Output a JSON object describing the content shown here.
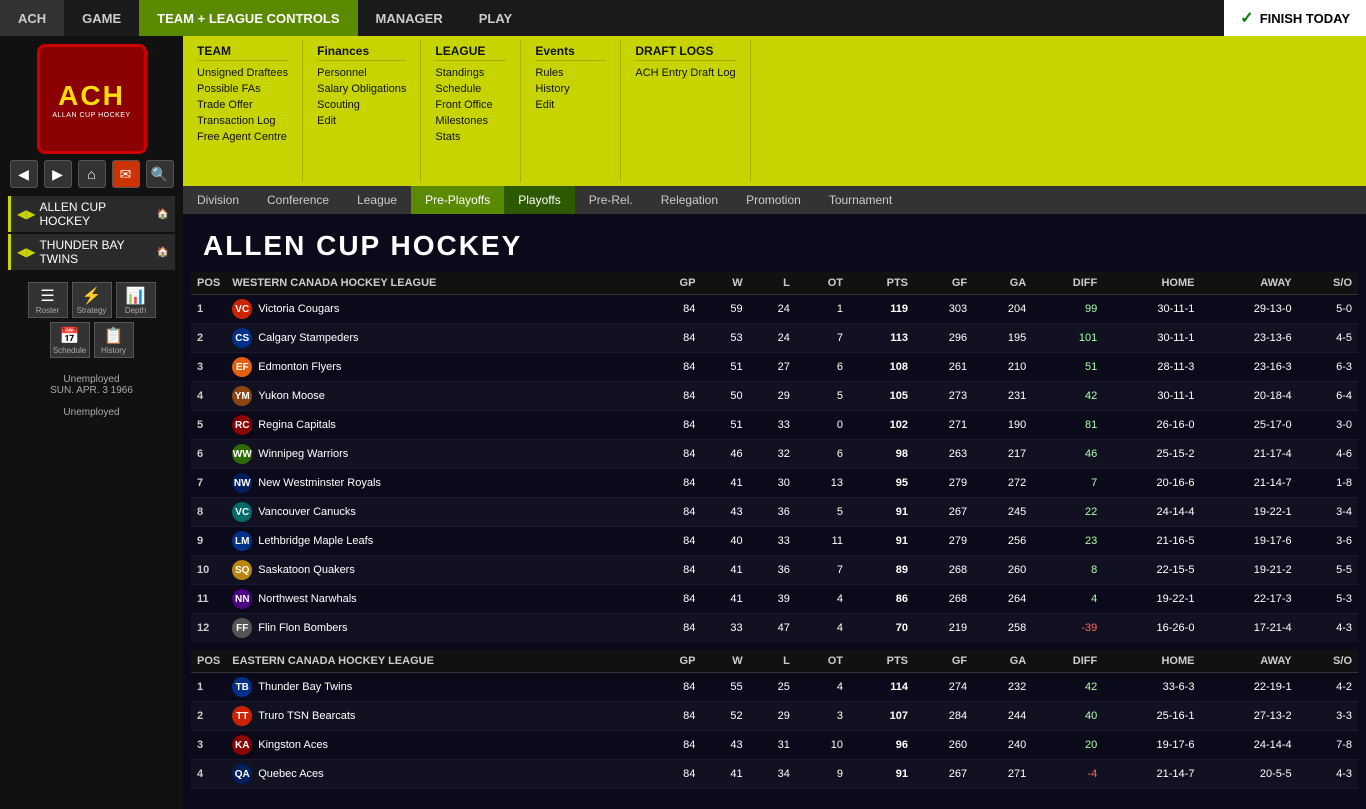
{
  "topNav": {
    "items": [
      {
        "label": "ACH",
        "active": false
      },
      {
        "label": "GAME",
        "active": false
      },
      {
        "label": "TEAM + LEAGUE CONTROLS",
        "active": true
      },
      {
        "label": "MANAGER",
        "active": false
      },
      {
        "label": "PLAY",
        "active": false
      }
    ],
    "finishToday": "FINISH TODAY"
  },
  "sidebar": {
    "logo": {
      "main": "ACH",
      "sub": "ALLAN CUP HOCKEY"
    },
    "userInfo": {
      "status": "Unemployed",
      "date": "SUN. APR. 3 1966",
      "role": "Unemployed"
    },
    "navButtons": [
      "◀",
      "▶",
      "⌂",
      "✉",
      "🔍"
    ],
    "teams": [
      {
        "label": "ALLEN CUP HOCKEY",
        "arrow": "◀▶"
      },
      {
        "label": "THUNDER BAY TWINS",
        "arrow": "◀▶"
      }
    ],
    "icons": [
      {
        "icon": "☰",
        "label": "Roster"
      },
      {
        "icon": "⚡",
        "label": "Strategy"
      },
      {
        "icon": "📊",
        "label": "Depth"
      },
      {
        "icon": "📅",
        "label": "Schedule"
      },
      {
        "icon": "📋",
        "label": "History"
      }
    ]
  },
  "megaMenu": {
    "team": {
      "header": "TEAM",
      "items": [
        "Unsigned Draftees",
        "Possible FAs",
        "Trade Offer",
        "Transaction Log",
        "Free Agent Centre"
      ]
    },
    "league": {
      "header": "LEAGUE",
      "items": [
        "Standings",
        "Schedule",
        "Front Office",
        "Milestones",
        "Stats"
      ]
    },
    "finances": {
      "header": "Finances",
      "items": [
        "Personnel",
        "Salary Obligations",
        "Scouting",
        "Edit"
      ]
    },
    "events": {
      "header": "Events",
      "items": [
        "Rules",
        "History",
        "Edit"
      ]
    },
    "draftLogs": {
      "header": "DRAFT LOGS",
      "items": [
        "ACH Entry Draft Log"
      ]
    }
  },
  "subNav": {
    "items": [
      {
        "label": "Division",
        "active": false
      },
      {
        "label": "Conference",
        "active": false
      },
      {
        "label": "League",
        "active": false
      },
      {
        "label": "Pre-Playoffs",
        "active": true
      },
      {
        "label": "Playoffs",
        "active": true
      },
      {
        "label": "Pre-Rel.",
        "active": false
      },
      {
        "label": "Relegation",
        "active": false
      },
      {
        "label": "Promotion",
        "active": false
      },
      {
        "label": "Tournament",
        "active": false
      }
    ]
  },
  "pageTitle": "ALLEN CUP HOCKEY",
  "westernLeague": {
    "name": "WESTERN CANADA HOCKEY LEAGUE",
    "columns": [
      "POS",
      "WESTERN CANADA HOCKEY LEAGUE",
      "GP",
      "W",
      "L",
      "OT",
      "PTS",
      "GF",
      "GA",
      "DIFF",
      "HOME",
      "AWAY",
      "S/O"
    ],
    "teams": [
      {
        "pos": 1,
        "name": "Victoria Cougars",
        "gp": 84,
        "w": 59,
        "l": 24,
        "ot": 1,
        "pts": 119,
        "gf": 303,
        "ga": 204,
        "diff": 99,
        "home": "30-11-1",
        "away": "29-13-0",
        "so": "5-0",
        "logo": "logo-red"
      },
      {
        "pos": 2,
        "name": "Calgary Stampeders",
        "gp": 84,
        "w": 53,
        "l": 24,
        "ot": 7,
        "pts": 113,
        "gf": 296,
        "ga": 195,
        "diff": 101,
        "home": "30-11-1",
        "away": "23-13-6",
        "so": "4-5",
        "logo": "logo-blue"
      },
      {
        "pos": 3,
        "name": "Edmonton Flyers",
        "gp": 84,
        "w": 51,
        "l": 27,
        "ot": 6,
        "pts": 108,
        "gf": 261,
        "ga": 210,
        "diff": 51,
        "home": "28-11-3",
        "away": "23-16-3",
        "so": "6-3",
        "logo": "logo-orange"
      },
      {
        "pos": 4,
        "name": "Yukon Moose",
        "gp": 84,
        "w": 50,
        "l": 29,
        "ot": 5,
        "pts": 105,
        "gf": 273,
        "ga": 231,
        "diff": 42,
        "home": "30-11-1",
        "away": "20-18-4",
        "so": "6-4",
        "logo": "logo-brown"
      },
      {
        "pos": 5,
        "name": "Regina Capitals",
        "gp": 84,
        "w": 51,
        "l": 33,
        "ot": 0,
        "pts": 102,
        "gf": 271,
        "ga": 190,
        "diff": 81,
        "home": "26-16-0",
        "away": "25-17-0",
        "so": "3-0",
        "logo": "logo-darkred"
      },
      {
        "pos": 6,
        "name": "Winnipeg Warriors",
        "gp": 84,
        "w": 46,
        "l": 32,
        "ot": 6,
        "pts": 98,
        "gf": 263,
        "ga": 217,
        "diff": 46,
        "home": "25-15-2",
        "away": "21-17-4",
        "so": "4-6",
        "logo": "logo-green"
      },
      {
        "pos": 7,
        "name": "New Westminster Royals",
        "gp": 84,
        "w": 41,
        "l": 30,
        "ot": 13,
        "pts": 95,
        "gf": 279,
        "ga": 272,
        "diff": 7,
        "home": "20-16-6",
        "away": "21-14-7",
        "so": "1-8",
        "logo": "logo-navy"
      },
      {
        "pos": 8,
        "name": "Vancouver Canucks",
        "gp": 84,
        "w": 43,
        "l": 36,
        "ot": 5,
        "pts": 91,
        "gf": 267,
        "ga": 245,
        "diff": 22,
        "home": "24-14-4",
        "away": "19-22-1",
        "so": "3-4",
        "logo": "logo-teal"
      },
      {
        "pos": 9,
        "name": "Lethbridge Maple Leafs",
        "gp": 84,
        "w": 40,
        "l": 33,
        "ot": 11,
        "pts": 91,
        "gf": 279,
        "ga": 256,
        "diff": 23,
        "home": "21-16-5",
        "away": "19-17-6",
        "so": "3-6",
        "logo": "logo-blue"
      },
      {
        "pos": 10,
        "name": "Saskatoon Quakers",
        "gp": 84,
        "w": 41,
        "l": 36,
        "ot": 7,
        "pts": 89,
        "gf": 268,
        "ga": 260,
        "diff": 8,
        "home": "22-15-5",
        "away": "19-21-2",
        "so": "5-5",
        "logo": "logo-gold"
      },
      {
        "pos": 11,
        "name": "Northwest Narwhals",
        "gp": 84,
        "w": 41,
        "l": 39,
        "ot": 4,
        "pts": 86,
        "gf": 268,
        "ga": 264,
        "diff": 4,
        "home": "19-22-1",
        "away": "22-17-3",
        "so": "5-3",
        "logo": "logo-purple"
      },
      {
        "pos": 12,
        "name": "Flin Flon Bombers",
        "gp": 84,
        "w": 33,
        "l": 47,
        "ot": 4,
        "pts": 70,
        "gf": 219,
        "ga": 258,
        "diff": -39,
        "home": "16-26-0",
        "away": "17-21-4",
        "so": "4-3",
        "logo": "logo-gray"
      }
    ]
  },
  "easternLeague": {
    "name": "EASTERN CANADA HOCKEY LEAGUE",
    "columns": [
      "POS",
      "EASTERN CANADA HOCKEY LEAGUE",
      "GP",
      "W",
      "L",
      "OT",
      "PTS",
      "GF",
      "GA",
      "DIFF",
      "HOME",
      "AWAY",
      "S/O"
    ],
    "teams": [
      {
        "pos": 1,
        "name": "Thunder Bay Twins",
        "gp": 84,
        "w": 55,
        "l": 25,
        "ot": 4,
        "pts": 114,
        "gf": 274,
        "ga": 232,
        "diff": 42,
        "home": "33-6-3",
        "away": "22-19-1",
        "so": "4-2",
        "logo": "logo-blue"
      },
      {
        "pos": 2,
        "name": "Truro TSN Bearcats",
        "gp": 84,
        "w": 52,
        "l": 29,
        "ot": 3,
        "pts": 107,
        "gf": 284,
        "ga": 244,
        "diff": 40,
        "home": "25-16-1",
        "away": "27-13-2",
        "so": "3-3",
        "logo": "logo-red"
      },
      {
        "pos": 3,
        "name": "Kingston Aces",
        "gp": 84,
        "w": 43,
        "l": 31,
        "ot": 10,
        "pts": 96,
        "gf": 260,
        "ga": 240,
        "diff": 20,
        "home": "19-17-6",
        "away": "24-14-4",
        "so": "7-8",
        "logo": "logo-darkred"
      },
      {
        "pos": 4,
        "name": "Quebec Aces",
        "gp": 84,
        "w": 41,
        "l": 34,
        "ot": 9,
        "pts": 91,
        "gf": 267,
        "ga": 271,
        "diff": -4,
        "home": "21-14-7",
        "away": "20-5-5",
        "so": "4-3",
        "logo": "logo-navy"
      }
    ]
  }
}
